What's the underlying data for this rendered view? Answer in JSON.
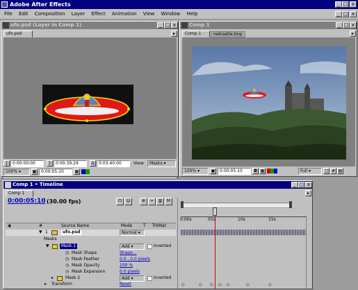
{
  "app": {
    "title": "Adobe After Effects",
    "menu": [
      "File",
      "Edit",
      "Composition",
      "Layer",
      "Effect",
      "Animation",
      "View",
      "Window",
      "Help"
    ],
    "window_buttons": [
      "_",
      "□",
      "x"
    ]
  },
  "layer_window": {
    "title": "ufo.psd (Layer in Comp 1)",
    "tab": "ufo.psd",
    "ruler_labels": [
      "00f",
      "01s",
      "02s",
      "03s"
    ],
    "in_time": "0:00:00:00",
    "out_time": "0:00:39:29",
    "duration": "0:03:40:00",
    "view_label": "View:",
    "view_value": "Masks",
    "zoom": "100%",
    "current_time": "0:00:05:10"
  },
  "comp_window": {
    "title": "Comp 1",
    "tabs": [
      "Comp 1",
      "redcastle.tmp"
    ],
    "zoom": "100%",
    "current_time": "0:00:05:10",
    "resolution": "Full"
  },
  "timeline": {
    "title": "Comp 1 • Timeline",
    "tab": "Comp 1",
    "current_time": "0:00:05:10",
    "fps": "(30.00 fps)",
    "columns": {
      "num": "#",
      "source": "Source Name",
      "mode": "Mode",
      "t": "T",
      "trkmat": "TrkMat"
    },
    "layer": {
      "num": "1",
      "name": "ufo.psd",
      "mode": "Normal"
    },
    "masks_label": "Masks",
    "mask1": {
      "name": "Mask 1",
      "mode": "Add",
      "inverted": "Inverted"
    },
    "props": [
      {
        "name": "Mask Shape",
        "value": "Shape..."
      },
      {
        "name": "Mask Feather",
        "value": "0.0 , 0.0 pixels"
      },
      {
        "name": "Mask Opacity",
        "value": "100 %"
      },
      {
        "name": "Mask Expansion",
        "value": "0.0 pixels"
      }
    ],
    "mask2": {
      "name": "Mask 2",
      "mode": "Add",
      "inverted": "Inverted"
    },
    "transform": {
      "name": "Transform",
      "value": "Reset"
    },
    "ruler": [
      "0:00s",
      "05s",
      "10s",
      "15s"
    ]
  },
  "colors": {
    "title_active": "#000080",
    "title_inactive": "#808080",
    "chrome": "#c0c0c0",
    "time_indicator": "#d00000",
    "link_blue": "#0000c0"
  },
  "icons": [
    "ae-app-icon",
    "ufo-layer-image",
    "castle-comp-image",
    "keyframe-icon",
    "eye-icon",
    "twirl-icon",
    "stopwatch-icon"
  ]
}
